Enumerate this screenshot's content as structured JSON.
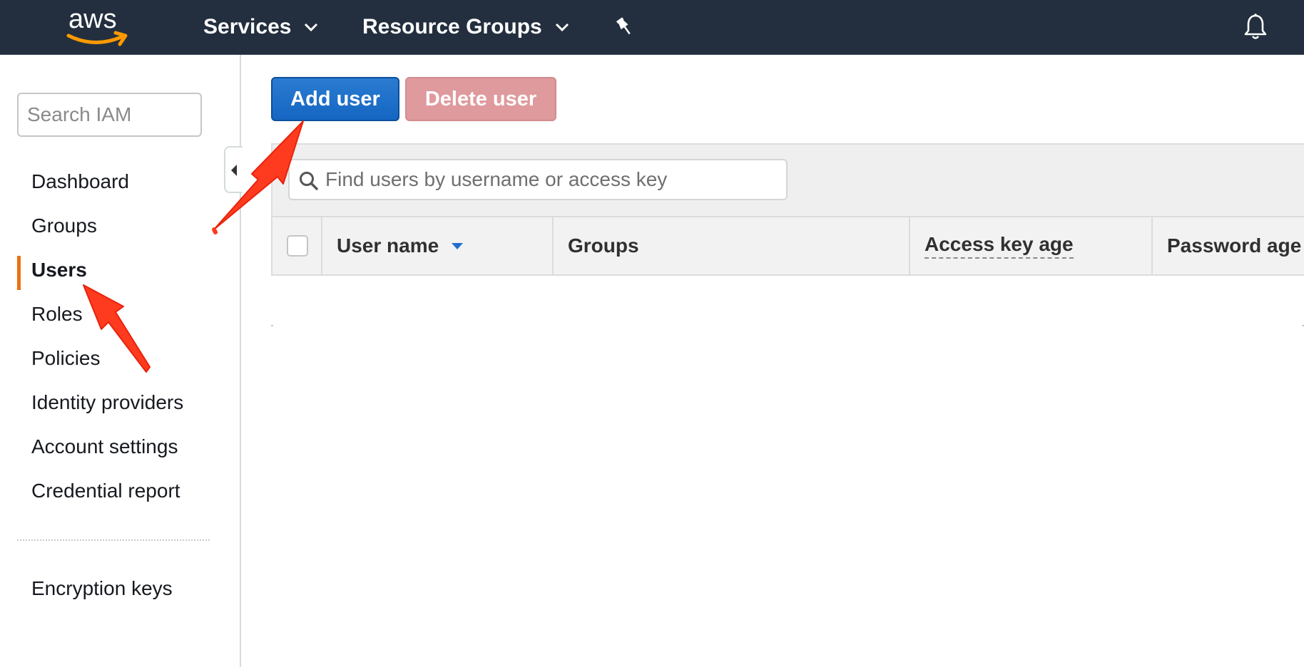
{
  "topnav": {
    "logo_text": "aws",
    "services_label": "Services",
    "resource_groups_label": "Resource Groups"
  },
  "sidebar": {
    "search_placeholder": "Search IAM",
    "items": [
      {
        "label": "Dashboard"
      },
      {
        "label": "Groups"
      },
      {
        "label": "Users"
      },
      {
        "label": "Roles"
      },
      {
        "label": "Policies"
      },
      {
        "label": "Identity providers"
      },
      {
        "label": "Account settings"
      },
      {
        "label": "Credential report"
      },
      {
        "label": "Encryption keys"
      }
    ],
    "active_item": "Users"
  },
  "toolbar": {
    "add_user_label": "Add user",
    "delete_user_label": "Delete user"
  },
  "filter": {
    "placeholder": "Find users by username or access key"
  },
  "table": {
    "columns": [
      {
        "label": "User name"
      },
      {
        "label": "Groups"
      },
      {
        "label": "Access key age"
      },
      {
        "label": "Password age"
      }
    ]
  },
  "colors": {
    "nav_bg": "#232f3e",
    "accent": "#ec7211",
    "primary_button": "#1466c2",
    "disabled_danger_button": "#df9a9d",
    "annotation_arrow": "#ff3b1f"
  }
}
